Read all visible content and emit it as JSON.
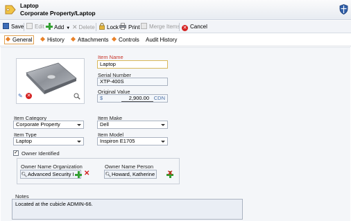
{
  "header": {
    "title": "Laptop",
    "subtitle": "Corporate Property/Laptop"
  },
  "toolbar": {
    "save": "Save",
    "edit": "Edit",
    "add": "Add",
    "delete": "Delete",
    "lock": "Lock",
    "print": "Print",
    "merge": "Merge Items",
    "cancel": "Cancel"
  },
  "tabs": [
    "General",
    "History",
    "Attachments",
    "Controls",
    "Audit History"
  ],
  "form": {
    "item_name": {
      "label": "Item Name",
      "value": "Laptop"
    },
    "serial_number": {
      "label": "Serial Number",
      "value": "XTP-400S"
    },
    "original_value": {
      "label": "Original Value",
      "currency_symbol": "$",
      "amount": "2,900.00",
      "currency": "CDN"
    },
    "item_category": {
      "label": "Item Category",
      "value": "Corporate Property"
    },
    "item_make": {
      "label": "Item Make",
      "value": "Dell"
    },
    "item_type": {
      "label": "Item Type",
      "value": "Laptop"
    },
    "item_model": {
      "label": "Item Model",
      "value": "Inspiron E1705"
    },
    "owner_identified": {
      "label": "Owner Identified",
      "checked": true
    },
    "owner_org": {
      "label": "Owner Name Organization",
      "value": "Advanced Security I"
    },
    "owner_person": {
      "label": "Owner Name Person",
      "value": "Howard, Katherine"
    },
    "notes": {
      "label": "Notes",
      "value": "Located at the cubicle ADMIN-66."
    }
  },
  "colors": {
    "accent_orange": "#e8822a",
    "required_label": "#c8352a",
    "add_green": "#33a033",
    "remove_red": "#d42020"
  }
}
